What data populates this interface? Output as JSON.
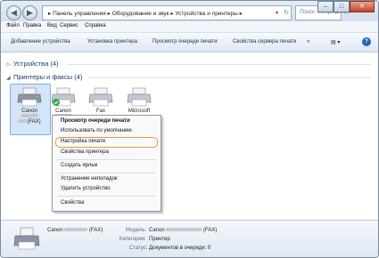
{
  "address": {
    "crumbs": [
      "Панель управления",
      "Оборудование и звук",
      "Устройства и принтеры"
    ],
    "sep": "▸",
    "search_placeholder": "Поиск: Устройств..."
  },
  "window_buttons": [
    "–",
    "□",
    "✕"
  ],
  "menu": [
    "Файл",
    "Правка",
    "Вид",
    "Сервис",
    "Справка"
  ],
  "toolbar": {
    "items": [
      "Добавление устройства",
      "Установка принтера",
      "Просмотр очереди печати",
      "Свойства сервера печати"
    ],
    "more": "»",
    "view_icon": "▤ ▾",
    "help_icon": "?"
  },
  "groups": {
    "devices": "Устройства (4)",
    "printers": "Принтеры и факсы (4)"
  },
  "printers": [
    {
      "line1": "Canon",
      "line3": "(FAX)"
    },
    {
      "line1": "Canon"
    },
    {
      "line1": "Fax"
    },
    {
      "line1": "Microsoft"
    }
  ],
  "context_menu": [
    "Просмотр очереди печати",
    "Использовать по умолчанию",
    "Настройка печати",
    "Свойства принтера",
    "Создать ярлык",
    "Устранение неполадок",
    "Удалить устройство",
    "Свойства"
  ],
  "details": {
    "name_prefix": "Canon",
    "name_suffix": "(FAX)",
    "model_key": "Модель:",
    "model_prefix": "Canon",
    "model_suffix": "(FAX)",
    "category_key": "Категория:",
    "category_val": "Принтер",
    "status_key": "Статус:",
    "status_val": "Документов в очереди: 0"
  },
  "colors": {
    "highlight_ring": "#f19a2b",
    "selection": "#d3e5f8",
    "group_text": "#1e3a6e"
  }
}
